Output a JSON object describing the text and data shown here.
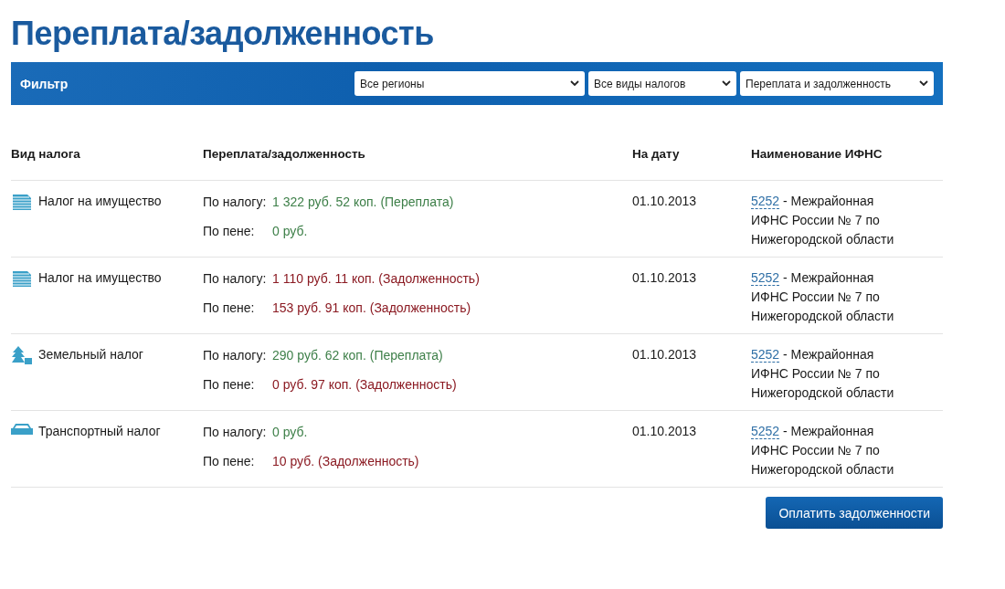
{
  "title": "Переплата/задолженность",
  "filter": {
    "label": "Фильтр",
    "selects": [
      {
        "value": "Все регионы"
      },
      {
        "value": "Все виды налогов"
      },
      {
        "value": "Переплата и задолженность"
      }
    ]
  },
  "table": {
    "columns": [
      "Вид налога",
      "Переплата/задолженность",
      "На дату",
      "Наименование ИФНС"
    ],
    "rows": [
      {
        "kind": "property",
        "tax": "Налог на имущество",
        "lines": [
          {
            "label": "По налогу:",
            "amount": "1 322 руб. 52 коп. (Переплата)",
            "kind": "overpayment"
          },
          {
            "label": "По пене:",
            "amount": "0 руб.",
            "kind": "overpayment"
          }
        ],
        "date": "01.10.2013",
        "code": "5252",
        "office": " - Межрайонная ИФНС России № 7 по Нижегородской области"
      },
      {
        "kind": "property",
        "tax": "Налог на имущество",
        "lines": [
          {
            "label": "По налогу:",
            "amount": "1 110 руб. 11 коп. (Задолженность)",
            "kind": "debt"
          },
          {
            "label": "По пене:",
            "amount": "153 руб. 91 коп. (Задолженность)",
            "kind": "debt"
          }
        ],
        "date": "01.10.2013",
        "code": "5252",
        "office": " - Межрайонная ИФНС России № 7 по Нижегородской области"
      },
      {
        "kind": "land",
        "tax": "Земельный налог",
        "lines": [
          {
            "label": "По налогу:",
            "amount": "290 руб. 62 коп. (Переплата)",
            "kind": "overpayment"
          },
          {
            "label": "По пене:",
            "amount": "0 руб. 97 коп. (Задолженность)",
            "kind": "debt"
          }
        ],
        "date": "01.10.2013",
        "code": "5252",
        "office": " - Межрайонная ИФНС России № 7 по Нижегородской области"
      },
      {
        "kind": "transport",
        "tax": "Транспортный налог",
        "lines": [
          {
            "label": "По налогу:",
            "amount": "0 руб.",
            "kind": "overpayment"
          },
          {
            "label": "По пене:",
            "amount": "10 руб. (Задолженность)",
            "kind": "debt"
          }
        ],
        "date": "01.10.2013",
        "code": "5252",
        "office": " - Межрайонная ИФНС России № 7 по Нижегородской области"
      }
    ]
  },
  "pay_button": "Оплатить задолженности"
}
